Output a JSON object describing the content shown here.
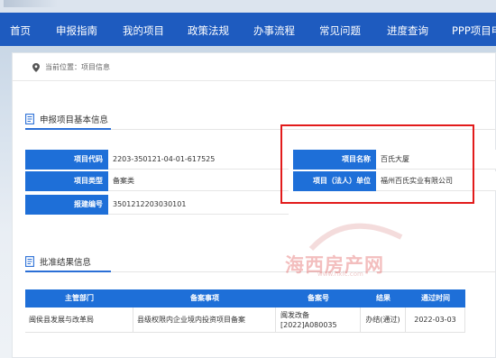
{
  "nav": {
    "items": [
      "首页",
      "申报指南",
      "我的项目",
      "政策法规",
      "办事流程",
      "常见问题",
      "进度查询",
      "PPP项目申"
    ]
  },
  "breadcrumb": "当前位置：项目信息",
  "basic_section": {
    "title": "申报项目基本信息",
    "rows": [
      {
        "label": "项目代码",
        "value": "2203-350121-04-01-617525"
      },
      {
        "label": "项目类型",
        "value": "备案类"
      },
      {
        "label": "报建编号",
        "value": "3501212203030101"
      }
    ],
    "right_rows": [
      {
        "label": "项目名称",
        "value": "百氏大厦"
      },
      {
        "label": "项目（法人）单位",
        "value": "福州百氏实业有限公司"
      }
    ]
  },
  "approval_section": {
    "title": "批准结果信息",
    "headers": [
      "主管部门",
      "备案事项",
      "备案号",
      "结果",
      "通过时间"
    ],
    "rows": [
      {
        "dept": "闽侯县发展与改革局",
        "item": "县级权限内企业境内投资项目备案",
        "no_line1": "闽发改备",
        "no_line2": "[2022]A080035",
        "result": "办结(通过)",
        "date": "2022-03-03"
      }
    ]
  },
  "watermark": {
    "text": "海西房产网",
    "sub": "www.hxfc.com"
  },
  "colors": {
    "nav": "#1e5bbf",
    "label_bg": "#1e6fd8",
    "highlight": "#e21b1b"
  }
}
